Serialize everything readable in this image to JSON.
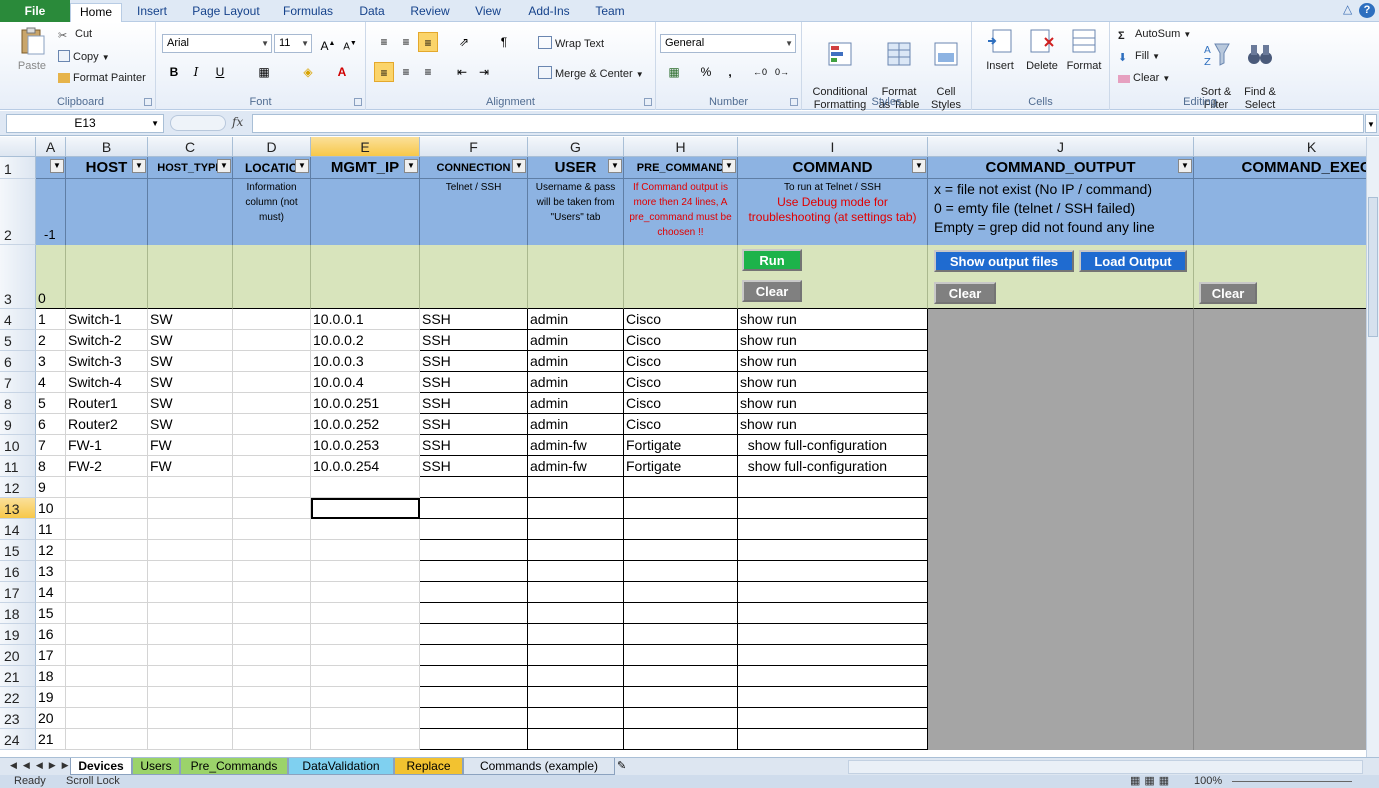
{
  "tabs": [
    "File",
    "Home",
    "Insert",
    "Page Layout",
    "Formulas",
    "Data",
    "Review",
    "View",
    "Add-Ins",
    "Team"
  ],
  "ribbon": {
    "clipboard": {
      "label": "Clipboard",
      "paste": "Paste",
      "cut": "Cut",
      "copy": "Copy",
      "format_painter": "Format Painter"
    },
    "font": {
      "label": "Font",
      "name": "Arial",
      "size": "11",
      "bold": "B",
      "italic": "I",
      "underline": "U"
    },
    "alignment": {
      "label": "Alignment",
      "wrap_text": "Wrap Text",
      "merge_center": "Merge & Center"
    },
    "number": {
      "label": "Number",
      "format": "General",
      "percent": "%",
      "comma": ","
    },
    "styles": {
      "label": "Styles",
      "conditional": "Conditional\nFormatting",
      "format_table": "Format\nas Table",
      "cell_styles": "Cell\nStyles"
    },
    "cells": {
      "label": "Cells",
      "insert": "Insert",
      "delete": "Delete",
      "format": "Format"
    },
    "editing": {
      "label": "Editing",
      "autosum": "AutoSum",
      "fill": "Fill",
      "clear": "Clear",
      "sort_filter": "Sort &\nFilter",
      "find_select": "Find &\nSelect"
    }
  },
  "formula_bar": {
    "name_box": "E13",
    "fx": "fx",
    "value": ""
  },
  "columns": [
    "A",
    "B",
    "C",
    "D",
    "E",
    "F",
    "G",
    "H",
    "I",
    "J",
    "K"
  ],
  "rows": [
    "1",
    "2",
    "3",
    "4",
    "5",
    "6",
    "7",
    "8",
    "9",
    "10",
    "11",
    "12",
    "13",
    "14",
    "15",
    "16",
    "17",
    "18",
    "19",
    "20",
    "21",
    "22",
    "23",
    "24"
  ],
  "headers": [
    "HOST",
    "HOST_TYPE",
    "LOCATIO",
    "MGMT_IP",
    "CONNECTION",
    "USER",
    "PRE_COMMAND",
    "COMMAND",
    "COMMAND_OUTPUT",
    "COMMAND_EXECU"
  ],
  "row2": {
    "a": "-1",
    "location": "Information column (not must)",
    "connection": "Telnet / SSH",
    "user": "Username & pass will be taken from \"Users\" tab",
    "pre_command": "If Command output is more then 24 lines, A pre_command must be choosen !!",
    "command_black": "To run at Telnet / SSH",
    "command_red": "Use Debug mode for troubleshooting (at settings tab)",
    "output_line1": "x = file not exist (No IP / command)",
    "output_line2": "0 = emty file (telnet / SSH failed)",
    "output_line3": "Empty = grep did not found any line"
  },
  "row3": {
    "a": "0"
  },
  "buttons": {
    "run": "Run",
    "clear": "Clear",
    "show_output": "Show output files",
    "load_output": "Load Output"
  },
  "data_rows": [
    {
      "a": "1",
      "host": "Switch-1",
      "type": "SW",
      "ip": "10.0.0.1",
      "conn": "SSH",
      "user": "admin",
      "pre": "Cisco",
      "cmd": "show run"
    },
    {
      "a": "2",
      "host": "Switch-2",
      "type": "SW",
      "ip": "10.0.0.2",
      "conn": "SSH",
      "user": "admin",
      "pre": "Cisco",
      "cmd": "show run"
    },
    {
      "a": "3",
      "host": "Switch-3",
      "type": "SW",
      "ip": "10.0.0.3",
      "conn": "SSH",
      "user": "admin",
      "pre": "Cisco",
      "cmd": "show run"
    },
    {
      "a": "4",
      "host": "Switch-4",
      "type": "SW",
      "ip": "10.0.0.4",
      "conn": "SSH",
      "user": "admin",
      "pre": "Cisco",
      "cmd": "show run"
    },
    {
      "a": "5",
      "host": "Router1",
      "type": "SW",
      "ip": "10.0.0.251",
      "conn": "SSH",
      "user": "admin",
      "pre": "Cisco",
      "cmd": "show run"
    },
    {
      "a": "6",
      "host": "Router2",
      "type": "SW",
      "ip": "10.0.0.252",
      "conn": "SSH",
      "user": "admin",
      "pre": "Cisco",
      "cmd": "show run"
    },
    {
      "a": "7",
      "host": "FW-1",
      "type": "FW",
      "ip": "10.0.0.253",
      "conn": "SSH",
      "user": "admin-fw",
      "pre": "Fortigate",
      "cmd": "  show full-configuration"
    },
    {
      "a": "8",
      "host": "FW-2",
      "type": "FW",
      "ip": "10.0.0.254",
      "conn": "SSH",
      "user": "admin-fw",
      "pre": "Fortigate",
      "cmd": "  show full-configuration"
    }
  ],
  "empty_row_a": [
    "9",
    "10",
    "11",
    "12",
    "13",
    "14",
    "15",
    "16",
    "17",
    "18",
    "19",
    "20",
    "21"
  ],
  "sheets": [
    "Devices",
    "Users",
    "Pre_Commands",
    "DataValidation",
    "Replace",
    "Commands (example)"
  ],
  "sheet_colors": [
    "#ffffff",
    "#9bd36a",
    "#9bd36a",
    "#7fd0f0",
    "#f2c230",
    "#dde6f1"
  ],
  "status": {
    "ready": "Ready",
    "scroll_lock": "Scroll Lock",
    "zoom": "100%"
  },
  "colors": {
    "header_blue": "#8db3e2",
    "green_row": "#d8e4bc",
    "gray_area": "#a5a5a5",
    "run_green": "#1db34a",
    "btn_blue": "#1f6bd0"
  }
}
